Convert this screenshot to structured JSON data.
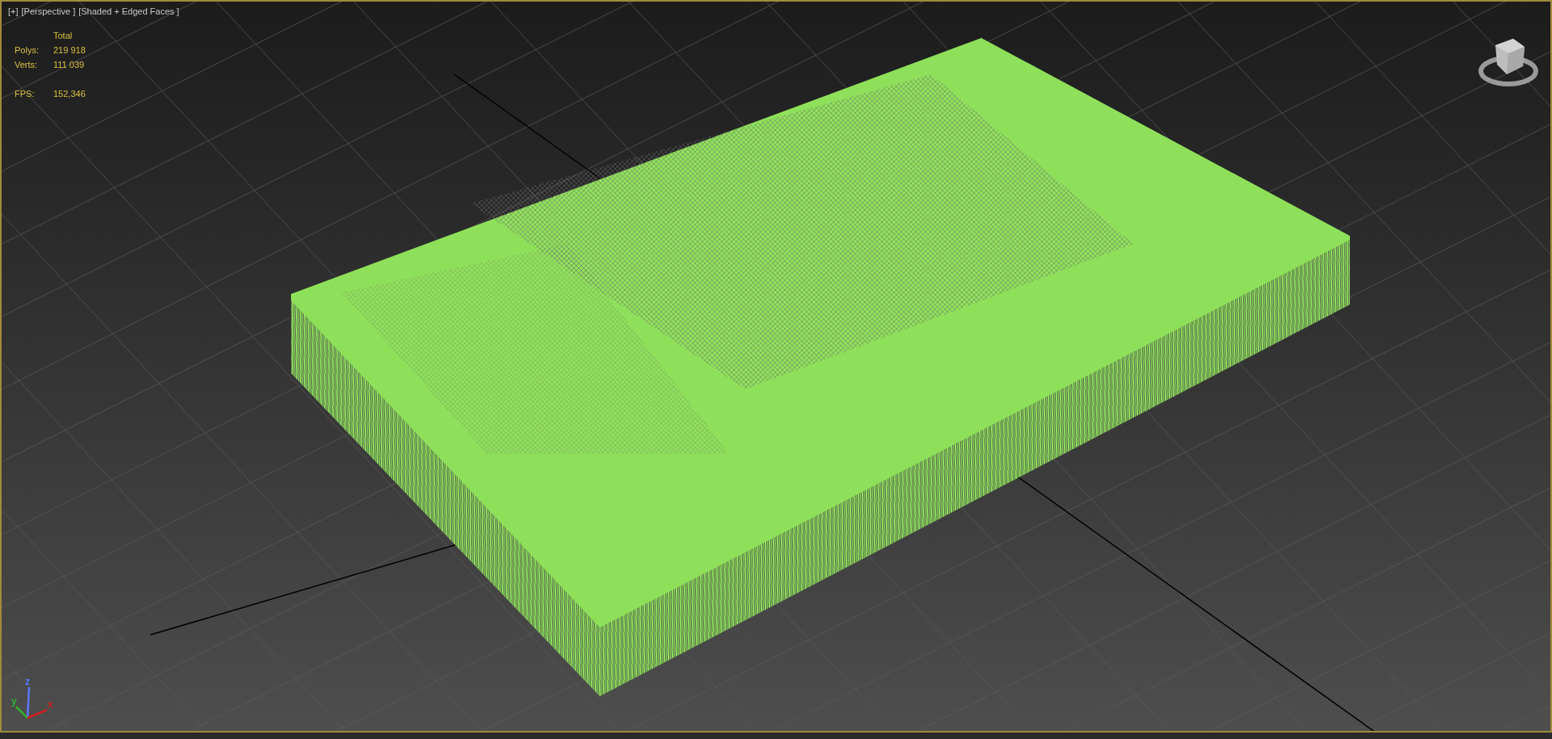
{
  "viewport": {
    "labels": [
      "[+]",
      "[Perspective ]",
      "[Shaded + Edged Faces ]"
    ],
    "stats": {
      "header": "Total",
      "rows": [
        {
          "label": "Polys:",
          "value": "219 918"
        },
        {
          "label": "Verts:",
          "value": "111 039"
        }
      ],
      "fps": {
        "label": "FPS:",
        "value": "152,346"
      }
    },
    "axes": [
      {
        "label": "z",
        "color": "#5a78ff"
      },
      {
        "label": "y",
        "color": "#30b030"
      },
      {
        "label": "x",
        "color": "#d02020"
      }
    ]
  }
}
